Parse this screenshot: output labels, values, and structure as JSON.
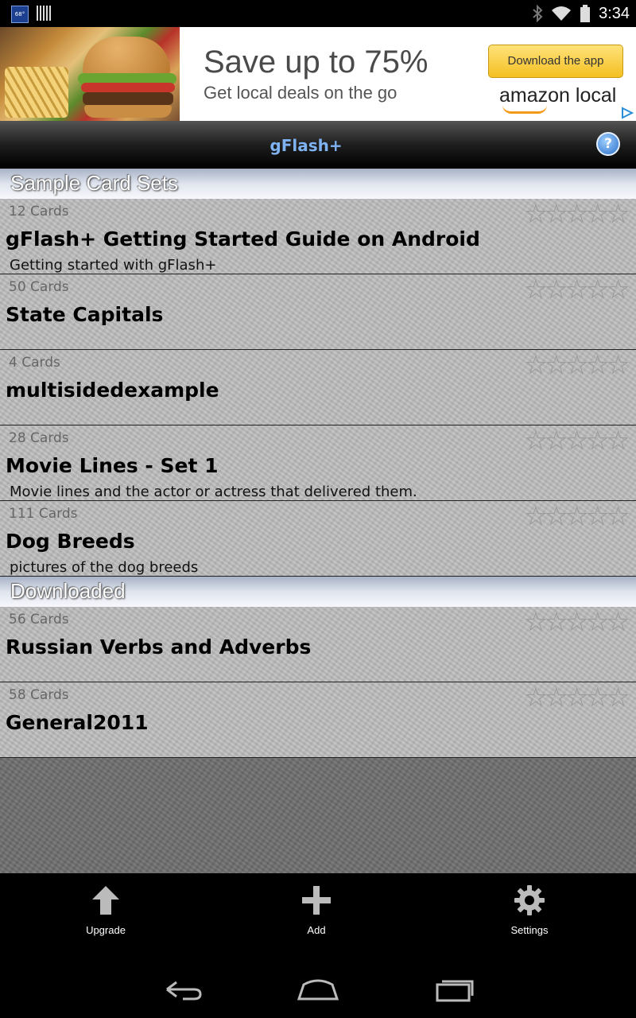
{
  "status_bar": {
    "weather_badge": "68°",
    "time": "3:34"
  },
  "ad": {
    "headline": "Save up to 75%",
    "subline": "Get local deals on the go",
    "button": "Download the app",
    "brand": "amazon local"
  },
  "app": {
    "title": "gFlash+",
    "help_label": "?"
  },
  "sections": [
    {
      "title": "Sample Card Sets",
      "cards": [
        {
          "count": "12 Cards",
          "title": "gFlash+ Getting Started Guide on Android",
          "description": "Getting started with gFlash+",
          "rating": 0
        },
        {
          "count": "50 Cards",
          "title": "State Capitals",
          "description": "",
          "rating": 0
        },
        {
          "count": "4 Cards",
          "title": "multisidedexample",
          "description": "",
          "rating": 0
        },
        {
          "count": "28 Cards",
          "title": "Movie Lines - Set 1",
          "description": "Movie lines and the actor or actress that delivered them.",
          "rating": 0
        },
        {
          "count": "111 Cards",
          "title": "Dog Breeds",
          "description": "pictures of the dog breeds",
          "rating": 0
        }
      ]
    },
    {
      "title": "Downloaded",
      "cards": [
        {
          "count": "56 Cards",
          "title": "Russian Verbs and Adverbs",
          "description": "",
          "rating": 0
        },
        {
          "count": "58 Cards",
          "title": "General2011",
          "description": "",
          "rating": 0
        }
      ]
    }
  ],
  "bottom_actions": {
    "upgrade": "Upgrade",
    "add": "Add",
    "settings": "Settings"
  },
  "colors": {
    "title_text": "#7fb2f0",
    "ad_button": "#f4c022",
    "section_header": "#dfe4ee"
  }
}
